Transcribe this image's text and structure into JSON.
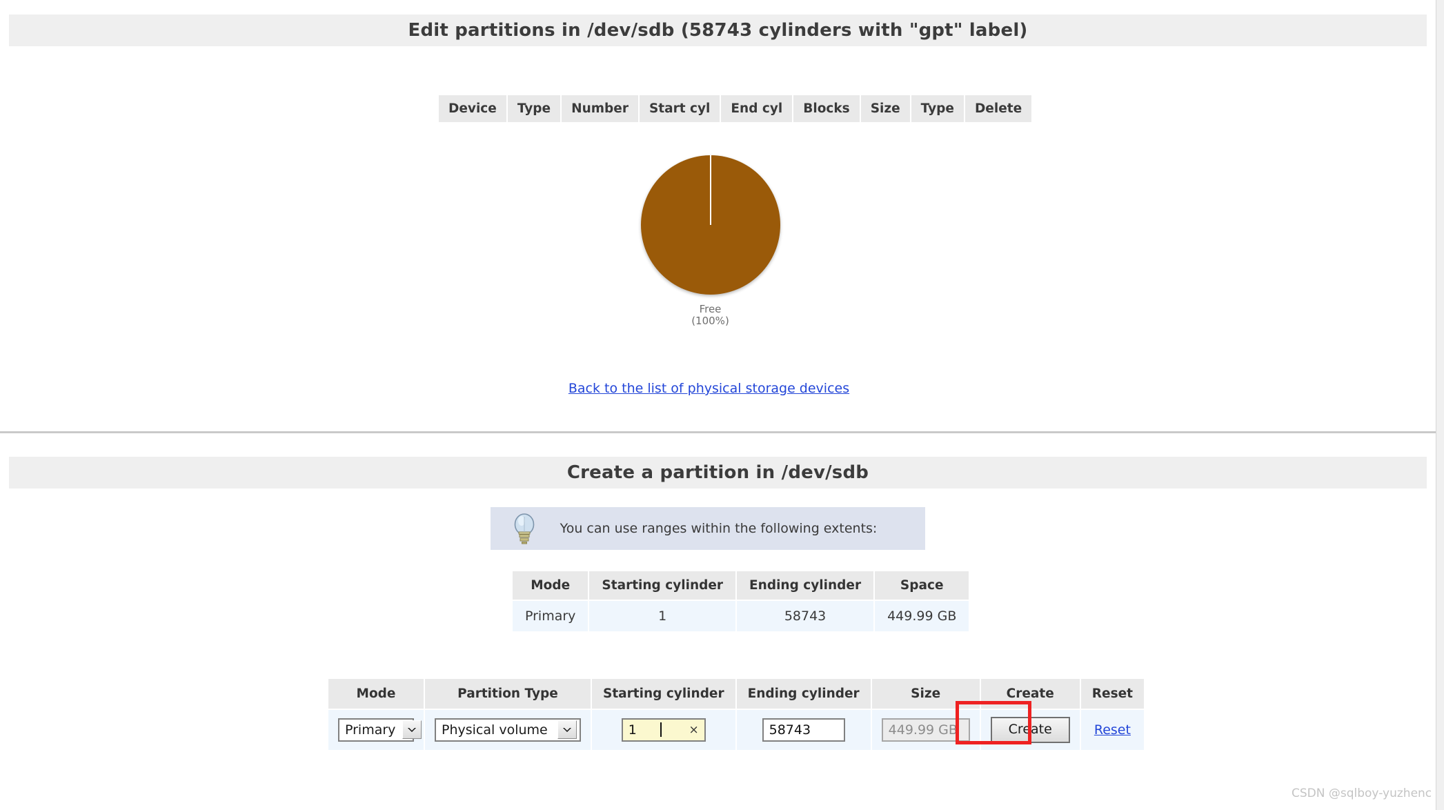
{
  "edit_section": {
    "title": "Edit partitions in /dev/sdb (58743 cylinders with \"gpt\" label)",
    "partitions_table": {
      "headers": [
        "Device",
        "Type",
        "Number",
        "Start cyl",
        "End cyl",
        "Blocks",
        "Size",
        "Type",
        "Delete"
      ],
      "rows": []
    },
    "back_link": "Back to the list of physical storage devices"
  },
  "chart_data": {
    "type": "pie",
    "title": "",
    "labels": [
      "Free"
    ],
    "values": [
      100
    ],
    "value_suffix": "%",
    "colors": [
      "#9a5a09"
    ],
    "legend": "below",
    "slice_labels": [
      "Free",
      "(100%)"
    ]
  },
  "create_section": {
    "title": "Create a partition in /dev/sdb",
    "hint": {
      "icon": "lightbulb-icon",
      "text": "You can use ranges within the following extents:"
    },
    "extents_table": {
      "headers": [
        "Mode",
        "Starting cylinder",
        "Ending cylinder",
        "Space"
      ],
      "rows": [
        [
          "Primary",
          "1",
          "58743",
          "449.99 GB"
        ]
      ]
    },
    "form_table": {
      "headers": [
        "Mode",
        "Partition Type",
        "Starting cylinder",
        "Ending cylinder",
        "Size",
        "Create",
        "Reset"
      ],
      "fields": {
        "mode_value": "Primary",
        "partition_type_value": "Physical volume",
        "starting_cylinder_value": "1",
        "starting_cylinder_clear": "×",
        "ending_cylinder_value": "58743",
        "size_value": "449.99 GB",
        "create_label": "Create",
        "reset_label": "Reset"
      }
    }
  },
  "annotation": {
    "highlight_color": "#ee2222",
    "target": "create-button"
  },
  "watermark": "CSDN @sqlboy-yuzhenc"
}
